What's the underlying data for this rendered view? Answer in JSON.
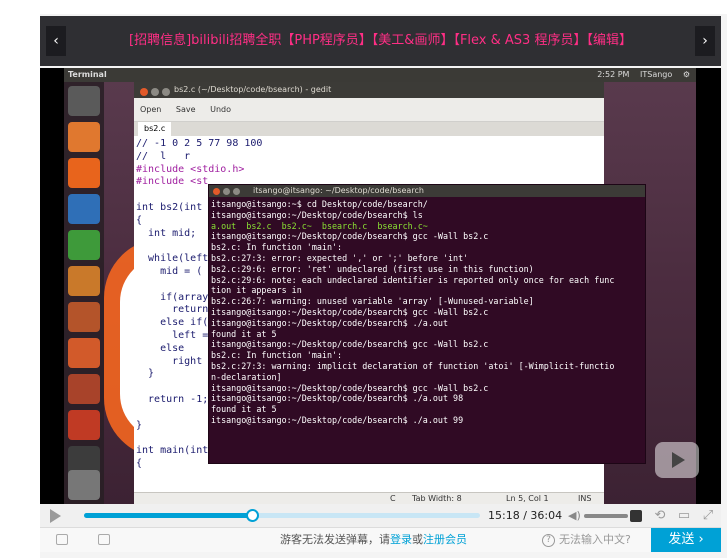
{
  "announcement": {
    "text": "[招聘信息]bilibili招聘全职【PHP程序员】【美工&画师】【Flex & AS3 程序员】【编辑】",
    "prev_icon": "chevron-left-icon",
    "next_icon": "chevron-right-icon"
  },
  "desktop": {
    "panel_title": "Terminal",
    "tray_time": "2:52 PM",
    "tray_user": "ITSango"
  },
  "gedit": {
    "title": "bs2.c (~/Desktop/code/bsearch) - gedit",
    "toolbar": [
      "Open",
      "Save",
      "Undo"
    ],
    "tab": "bs2.c",
    "code_lines": [
      "// -1 0 2 5 77 98 100",
      "//  l   r",
      "#include <stdio.h>",
      "#include <st",
      "",
      "int bs2(int",
      "{",
      "  int mid;",
      "",
      "  while(left",
      "    mid = (",
      "",
      "    if(array",
      "      return",
      "    else if(",
      "      left =",
      "    else",
      "      right",
      "  }",
      "",
      "  return -1;",
      "",
      "}",
      "",
      "int main(int argc, char** argv)",
      "{"
    ],
    "status_lang": "C",
    "status_tab": "Tab Width: 8",
    "status_pos": "Ln 5, Col 1",
    "status_mode": "INS"
  },
  "terminal": {
    "title": "itsango@itsango: ~/Desktop/code/bsearch",
    "lines": [
      "itsango@itsango:~$ cd Desktop/code/bsearch/",
      "itsango@itsango:~/Desktop/code/bsearch$ ls",
      "a.out  bs2.c  bs2.c~  bsearch.c  bsearch.c~",
      "itsango@itsango:~/Desktop/code/bsearch$ gcc -Wall bs2.c",
      "bs2.c: In function 'main':",
      "bs2.c:27:3: error: expected ',' or ';' before 'int'",
      "bs2.c:29:6: error: 'ret' undeclared (first use in this function)",
      "bs2.c:29:6: note: each undeclared identifier is reported only once for each func",
      "tion it appears in",
      "bs2.c:26:7: warning: unused variable 'array' [-Wunused-variable]",
      "itsango@itsango:~/Desktop/code/bsearch$ gcc -Wall bs2.c",
      "itsango@itsango:~/Desktop/code/bsearch$ ./a.out",
      "found it at 5",
      "itsango@itsango:~/Desktop/code/bsearch$ gcc -Wall bs2.c",
      "bs2.c: In function 'main':",
      "bs2.c:27:3: warning: implicit declaration of function 'atoi' [-Wimplicit-functio",
      "n-declaration]",
      "itsango@itsango:~/Desktop/code/bsearch$ gcc -Wall bs2.c",
      "itsango@itsango:~/Desktop/code/bsearch$ ./a.out 98",
      "found it at 5",
      "itsango@itsango:~/Desktop/code/bsearch$ ./a.out 99"
    ]
  },
  "player": {
    "current_time": "15:18",
    "separator": "/",
    "total_time": "36:04",
    "progress_fraction": 0.424,
    "play_icon": "play-icon",
    "volume_icon": "volume-icon",
    "accent_color": "#00a1d6"
  },
  "danmaku": {
    "guest_msg": "游客无法发送弹幕，请",
    "login": "登录",
    "or": "或",
    "register": "注册会员",
    "help": "无法输入中文?",
    "send": "发送",
    "send_arrow": "›"
  }
}
